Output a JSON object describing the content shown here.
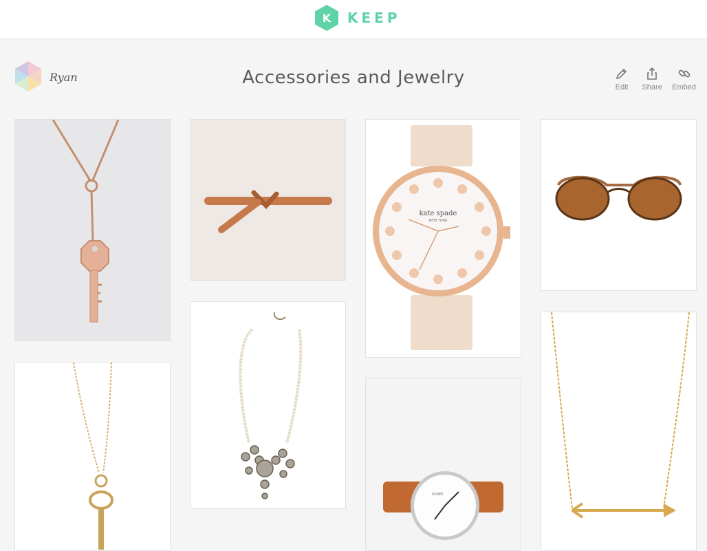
{
  "brand": {
    "logo_letter": "K",
    "logo_word": "KEEP",
    "accent_color": "#5fd3a8"
  },
  "board": {
    "owner_name": "Ryan",
    "title": "Accessories and Jewelry"
  },
  "actions": [
    {
      "label": "Edit",
      "icon": "pencil-icon"
    },
    {
      "label": "Share",
      "icon": "share-icon"
    },
    {
      "label": "Embed",
      "icon": "link-icon"
    }
  ],
  "products": [
    {
      "name": "rose-gold-key-necklace",
      "icon": "key-necklace"
    },
    {
      "name": "tan-leather-knot-belt",
      "icon": "belt"
    },
    {
      "name": "kate-spade-rose-gold-watch",
      "icon": "watch",
      "watch_brand": "kate spade",
      "watch_sub": "NEW YORK"
    },
    {
      "name": "tortoise-cat-eye-sunglasses",
      "icon": "sunglasses"
    },
    {
      "name": "pearl-crystal-statement-necklace",
      "icon": "statement-necklace"
    },
    {
      "name": "gold-skeleton-key-necklace",
      "icon": "skeleton-key"
    },
    {
      "name": "brown-leather-white-dial-watch",
      "icon": "watch",
      "watch_brand": "KOREE"
    },
    {
      "name": "gold-arrow-necklace",
      "icon": "arrow-necklace"
    }
  ]
}
